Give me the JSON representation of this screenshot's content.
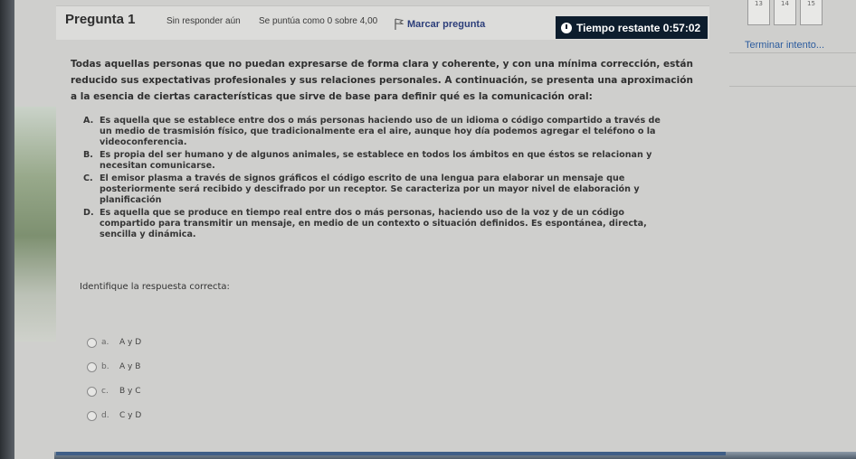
{
  "header": {
    "question_title": "Pregunta 1",
    "status": "Sin responder aún",
    "score": "Se puntúa como 0 sobre 4,00",
    "flag_label": "Marcar pregunta",
    "timer_label": "Tiempo restante 0:57:02"
  },
  "nav": {
    "boxes": [
      "13",
      "14",
      "15"
    ],
    "finish_label": "Terminar intento..."
  },
  "question": {
    "lines": [
      "Todas aquellas personas que no puedan expresarse de forma clara y coherente, y con una mínima corrección, están",
      "reducido sus expectativas profesionales y sus relaciones personales.  A continuación, se presenta una aproximación",
      "a la esencia de ciertas características que sirve de base para definir qué es la comunicación oral:"
    ],
    "options": [
      {
        "letter": "A.",
        "first": "Es aquella que se establece entre dos o más personas haciendo uso de un idioma o código compartido a través de",
        "rest": [
          "un medio de trasmisión físico, que tradicionalmente era el aire, aunque hoy día podemos agregar el teléfono o la",
          "videoconferencia."
        ]
      },
      {
        "letter": "B.",
        "first": "Es propia del ser humano y de algunos animales, se establece en todos los ámbitos en que éstos se relacionan y",
        "rest": [
          "necesitan comunicarse."
        ]
      },
      {
        "letter": "C.",
        "first": "El emisor plasma a través de signos gráficos el código escrito de una lengua para elaborar un mensaje que",
        "rest": [
          "posteriormente será recibido y descifrado por un receptor. Se caracteriza por un mayor nivel de elaboración y",
          "planificación"
        ]
      },
      {
        "letter": "D.",
        "first": "Es aquella que se produce en tiempo real entre dos o más personas, haciendo uso de la voz y de un código",
        "rest": [
          "compartido para transmitir un mensaje, en medio de un contexto o situación definidos. Es espontánea, directa,",
          "sencilla y dinámica."
        ]
      }
    ],
    "instruction": "Identifique la respuesta correcta:"
  },
  "answers": [
    {
      "letter": "a.",
      "text": "A y D"
    },
    {
      "letter": "b.",
      "text": "A y B"
    },
    {
      "letter": "c.",
      "text": "B y C"
    },
    {
      "letter": "d.",
      "text": "C y D"
    }
  ],
  "colors": {
    "timer_bg": "#0d1d2d",
    "link": "#2c5c9e",
    "flag": "#2c3e7a"
  }
}
